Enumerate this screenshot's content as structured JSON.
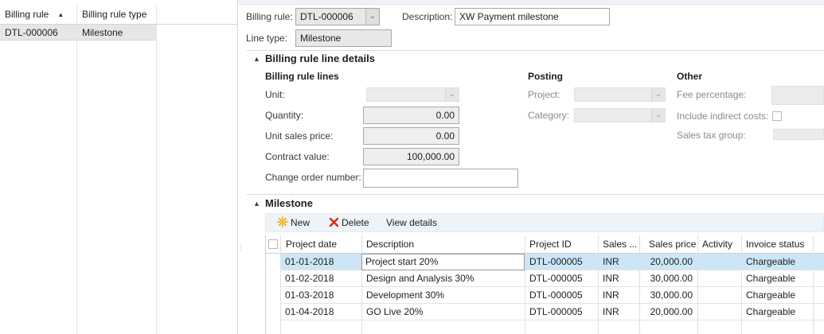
{
  "left_grid": {
    "columns": [
      "Billing rule",
      "Billing rule type"
    ],
    "rows": [
      {
        "rule": "DTL-000006",
        "type": "Milestone"
      }
    ]
  },
  "header": {
    "billing_rule_label": "Billing rule:",
    "billing_rule_value": "DTL-000006",
    "description_label": "Description:",
    "description_value": "XW Payment milestone",
    "line_type_label": "Line type:",
    "line_type_value": "Milestone"
  },
  "details": {
    "section_title": "Billing rule line details",
    "lines": {
      "title": "Billing rule lines",
      "unit_label": "Unit:",
      "quantity_label": "Quantity:",
      "quantity_value": "0.00",
      "unit_price_label": "Unit sales price:",
      "unit_price_value": "0.00",
      "contract_value_label": "Contract value:",
      "contract_value_value": "100,000.00",
      "change_order_label": "Change order number:",
      "change_order_value": ""
    },
    "posting": {
      "title": "Posting",
      "project_label": "Project:",
      "category_label": "Category:"
    },
    "other": {
      "title": "Other",
      "fee_label": "Fee percentage:",
      "indirect_label": "Include indirect costs:",
      "tax_label": "Sales tax group:"
    }
  },
  "milestone": {
    "section_title": "Milestone",
    "toolbar": {
      "new_label": "New",
      "delete_label": "Delete",
      "view_label": "View details"
    },
    "columns": [
      "Project date",
      "Description",
      "Project ID",
      "Sales ...",
      "Sales price",
      "Activity",
      "Invoice status"
    ],
    "rows": [
      {
        "date": "01-01-2018",
        "description": "Project start 20%",
        "project_id": "DTL-000005",
        "currency": "INR",
        "price": "20,000.00",
        "activity": "",
        "status": "Chargeable"
      },
      {
        "date": "01-02-2018",
        "description": "Design and Analysis 30%",
        "project_id": "DTL-000005",
        "currency": "INR",
        "price": "30,000.00",
        "activity": "",
        "status": "Chargeable"
      },
      {
        "date": "01-03-2018",
        "description": "Development 30%",
        "project_id": "DTL-000005",
        "currency": "INR",
        "price": "30,000.00",
        "activity": "",
        "status": "Chargeable"
      },
      {
        "date": "01-04-2018",
        "description": "GO Live 20%",
        "project_id": "DTL-000005",
        "currency": "INR",
        "price": "20,000.00",
        "activity": "",
        "status": "Chargeable"
      }
    ]
  },
  "colors": {
    "selected_row": "#cde6f7",
    "readonly_field": "#e8e8e8",
    "toolbar_bg": "#eef3f7"
  },
  "icons": {
    "new": "sparkle-icon",
    "delete": "red-x-icon",
    "sort": "sort-ascending-icon",
    "collapse": "collapse-triangle-icon"
  }
}
